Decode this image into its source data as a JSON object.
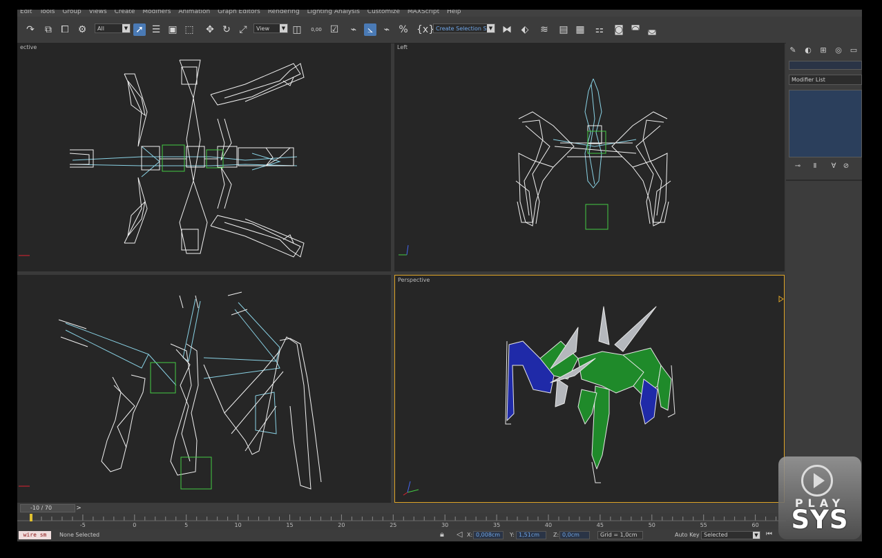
{
  "menu": [
    "Edit",
    "Tools",
    "Group",
    "Views",
    "Create",
    "Modifiers",
    "Animation",
    "Graph Editors",
    "Rendering",
    "Lighting Analysis",
    "Customize",
    "MAXScript",
    "Help"
  ],
  "toolbar": {
    "filter": "All",
    "coord_system": "View",
    "named_selection": "Create Selection Se",
    "percent_snap": "0,00"
  },
  "viewports": {
    "top": {
      "label": "ective"
    },
    "left": {
      "label": "Left"
    },
    "front": {
      "label": ""
    },
    "perspective": {
      "label": "Perspective"
    }
  },
  "command_panel": {
    "modifier_list": "Modifier List"
  },
  "timeline": {
    "slider": "-10 / 70",
    "ticks": [
      -5,
      0,
      5,
      10,
      15,
      20,
      25,
      30,
      35,
      40,
      45,
      50,
      55,
      60
    ]
  },
  "status": {
    "maxscript": "wire sm",
    "selection": "None Selected",
    "x_value": "0,008cm",
    "y_value": "1,51cm",
    "z_value": "0,0cm",
    "grid": "Grid = 1,0cm",
    "autokey": "Auto Key",
    "key_filter": "Selected",
    "x_label": "X:",
    "y_label": "Y:",
    "z_label": "Z:"
  },
  "logo": {
    "line1": "PLAY",
    "line2": "SYS"
  },
  "colors": {
    "viewport_bg": "#262626",
    "active_border": "#e0a526",
    "wire_white": "#f2f2f2",
    "wire_cyan": "#8ad3e6",
    "selection_green": "#44cc44",
    "mesh_blue": "#1f2aa8",
    "mesh_green": "#1f8a2a",
    "mesh_gray": "#b5b8bd"
  }
}
